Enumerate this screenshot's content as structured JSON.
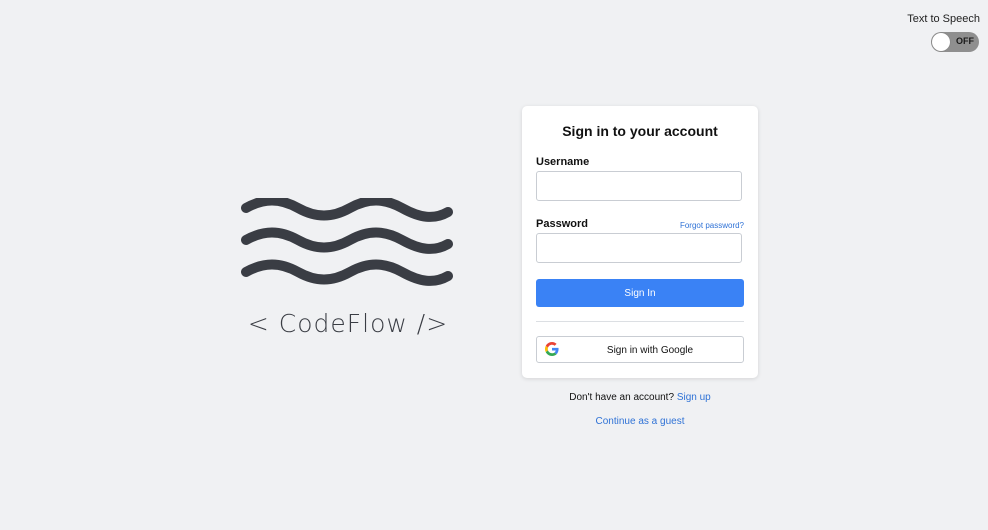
{
  "accessibility": {
    "tts_label": "Text to Speech",
    "tts_state": "OFF"
  },
  "brand": {
    "logo_text": "< CodeFlow />",
    "logo_icon": "waves-icon",
    "logo_color": "#3a3d44"
  },
  "login": {
    "title": "Sign in to your account",
    "username_label": "Username",
    "username_value": "",
    "password_label": "Password",
    "password_value": "",
    "forgot_password": "Forgot password?",
    "sign_in_button": "Sign In",
    "google_button": "Sign in with Google",
    "google_icon": "google-icon"
  },
  "footer": {
    "no_account_text": "Don't have an account?",
    "sign_up_link": "Sign up",
    "guest_link": "Continue as a guest"
  },
  "colors": {
    "background": "#f0f1f3",
    "primary": "#3a82f5",
    "link": "#2f72d6"
  }
}
